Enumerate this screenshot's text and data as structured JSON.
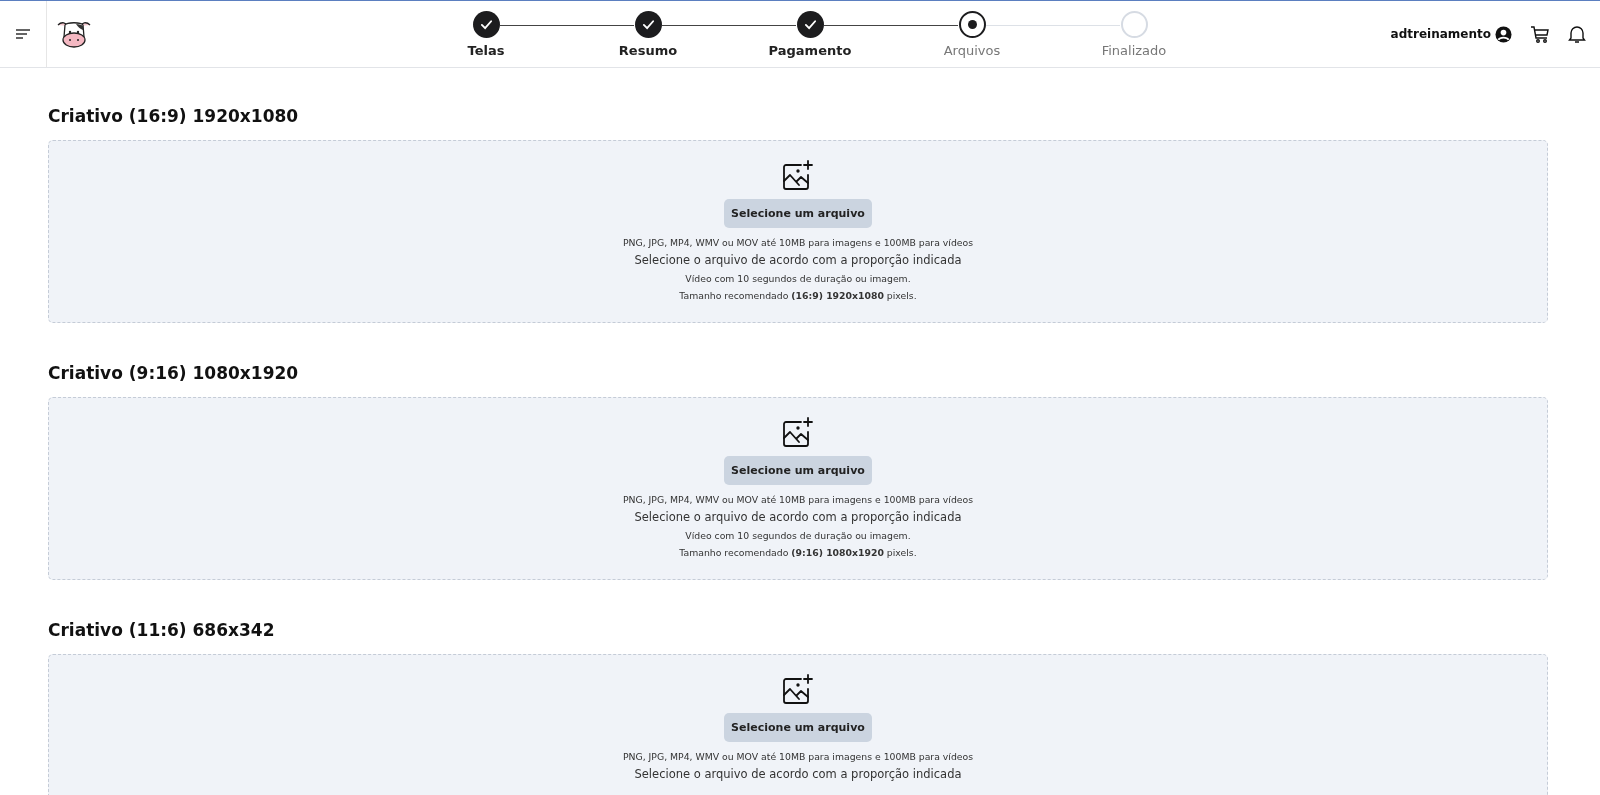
{
  "header": {
    "user": "adtreinamento"
  },
  "steps": [
    {
      "label": "Telas",
      "completed": true,
      "current": false
    },
    {
      "label": "Resumo",
      "completed": true,
      "current": false
    },
    {
      "label": "Pagamento",
      "completed": true,
      "current": false
    },
    {
      "label": "Arquivos",
      "completed": false,
      "current": true
    },
    {
      "label": "Finalizado",
      "completed": false,
      "current": false
    }
  ],
  "sections": [
    {
      "title": "Criativo (16:9) 1920x1080",
      "button": "Selecione um arquivo",
      "lines": [
        {
          "kind": "formats",
          "text": "PNG, JPG, MP4, WMV ou MOV até 10MB para imagens e 100MB para vídeos"
        },
        {
          "kind": "hint",
          "text": "Selecione o arquivo de acordo com a proporção indicada"
        },
        {
          "kind": "note",
          "text": "Vídeo com 10 segundos de duração ou imagem."
        },
        {
          "kind": "note",
          "text": "Tamanho recomendado **(16:9) 1920x1080** pixels."
        }
      ]
    },
    {
      "title": "Criativo (9:16) 1080x1920",
      "button": "Selecione um arquivo",
      "lines": [
        {
          "kind": "formats",
          "text": "PNG, JPG, MP4, WMV ou MOV até 10MB para imagens e 100MB para vídeos"
        },
        {
          "kind": "hint",
          "text": "Selecione o arquivo de acordo com a proporção indicada"
        },
        {
          "kind": "note",
          "text": "Vídeo com 10 segundos de duração ou imagem."
        },
        {
          "kind": "note",
          "text": "Tamanho recomendado **(9:16) 1080x1920** pixels."
        }
      ]
    },
    {
      "title": "Criativo (11:6) 686x342",
      "button": "Selecione um arquivo",
      "lines": [
        {
          "kind": "formats",
          "text": "PNG, JPG, MP4, WMV ou MOV até 10MB para imagens e 100MB para vídeos"
        },
        {
          "kind": "hint",
          "text": "Selecione o arquivo de acordo com a proporção indicada"
        }
      ]
    }
  ]
}
